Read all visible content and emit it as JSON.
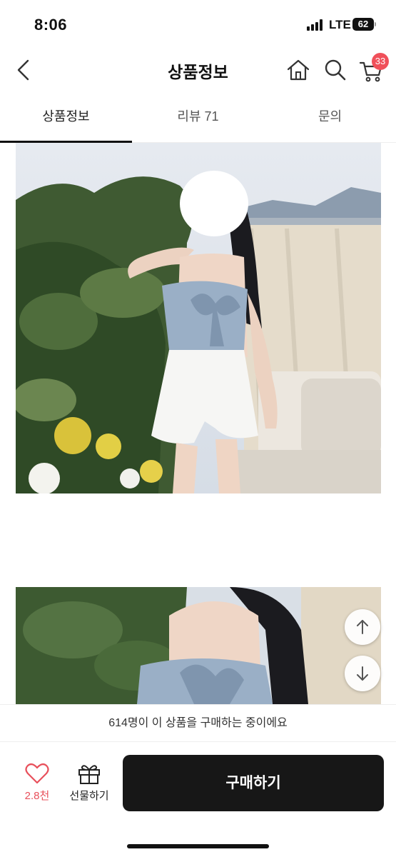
{
  "status_bar": {
    "time": "8:06",
    "network": "LTE",
    "battery": "62"
  },
  "header": {
    "title": "상품정보",
    "cart_badge": "33",
    "icons": [
      "back-chevron-icon",
      "home-icon",
      "search-icon",
      "cart-icon"
    ]
  },
  "tabs": [
    {
      "label": "상품정보",
      "active": true
    },
    {
      "label": "리뷰 71",
      "active": false
    },
    {
      "label": "문의",
      "active": false
    }
  ],
  "scroll_buttons": [
    "arrow-up-icon",
    "arrow-down-icon"
  ],
  "banner": {
    "text": "614명이 이 상품을 구매하는 중이에요"
  },
  "bottom_bar": {
    "like_count": "2.8천",
    "gift_label": "선물하기",
    "buy_label": "구매하기"
  },
  "colors": {
    "accent": "#e8505b",
    "badge": "#f0505a",
    "buy_button": "#171717"
  }
}
